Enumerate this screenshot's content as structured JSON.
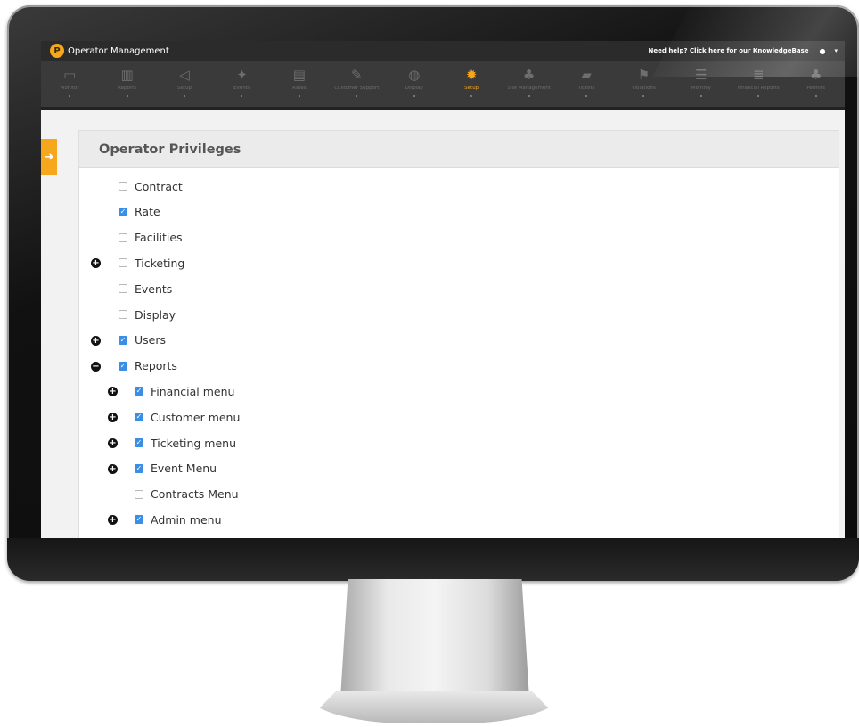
{
  "app": {
    "title": "Operator Management",
    "logo_letter": "P",
    "help_text": "Need help? Click here for our KnowledgeBase",
    "user_icon": "person-icon",
    "caret_icon": "caret-down-icon"
  },
  "nav": {
    "items": [
      {
        "label": "Monitor",
        "icon": "monitor-icon",
        "glyph": "▭"
      },
      {
        "label": "Reports",
        "icon": "chart-icon",
        "glyph": "▥"
      },
      {
        "label": "Setup",
        "icon": "megaphone-icon",
        "glyph": "◁"
      },
      {
        "label": "Events",
        "icon": "star-icon",
        "glyph": "✦"
      },
      {
        "label": "Rates",
        "icon": "card-icon",
        "glyph": "▤"
      },
      {
        "label": "Customer Support",
        "icon": "edit-icon",
        "glyph": "✎"
      },
      {
        "label": "Display",
        "icon": "globe-icon",
        "glyph": "◍"
      },
      {
        "label": "Setup",
        "icon": "gear-icon",
        "glyph": "✹",
        "active": true
      },
      {
        "label": "Site Management",
        "icon": "hierarchy-icon",
        "glyph": "♣"
      },
      {
        "label": "Tickets",
        "icon": "chat-icon",
        "glyph": "▰"
      },
      {
        "label": "Violations",
        "icon": "flag-icon",
        "glyph": "⚑"
      },
      {
        "label": "Monthly",
        "icon": "list-icon",
        "glyph": "☰"
      },
      {
        "label": "Financial Reports",
        "icon": "list-detail-icon",
        "glyph": "≣"
      },
      {
        "label": "Permits",
        "icon": "hierarchy-icon",
        "glyph": "♣"
      }
    ]
  },
  "panel": {
    "title": "Operator Privileges",
    "toggle_icon": "arrow-right-icon"
  },
  "privileges": [
    {
      "label": "Contract",
      "checked": false,
      "level": 0,
      "expander": null
    },
    {
      "label": "Rate",
      "checked": true,
      "level": 0,
      "expander": null
    },
    {
      "label": "Facilities",
      "checked": false,
      "level": 0,
      "expander": null
    },
    {
      "label": "Ticketing",
      "checked": false,
      "level": 0,
      "expander": "plus"
    },
    {
      "label": "Events",
      "checked": false,
      "level": 0,
      "expander": null
    },
    {
      "label": "Display",
      "checked": false,
      "level": 0,
      "expander": null
    },
    {
      "label": "Users",
      "checked": true,
      "level": 0,
      "expander": "plus"
    },
    {
      "label": "Reports",
      "checked": true,
      "level": 0,
      "expander": "minus"
    },
    {
      "label": "Financial menu",
      "checked": true,
      "level": 1,
      "expander": "plus"
    },
    {
      "label": "Customer menu",
      "checked": true,
      "level": 1,
      "expander": "plus"
    },
    {
      "label": "Ticketing menu",
      "checked": true,
      "level": 1,
      "expander": "plus"
    },
    {
      "label": "Event Menu",
      "checked": true,
      "level": 1,
      "expander": "plus"
    },
    {
      "label": "Contracts Menu",
      "checked": false,
      "level": 1,
      "expander": null
    },
    {
      "label": "Admin menu",
      "checked": true,
      "level": 1,
      "expander": "plus"
    }
  ],
  "colors": {
    "accent": "#f7a71c",
    "checkbox_checked": "#3a8ee6"
  }
}
